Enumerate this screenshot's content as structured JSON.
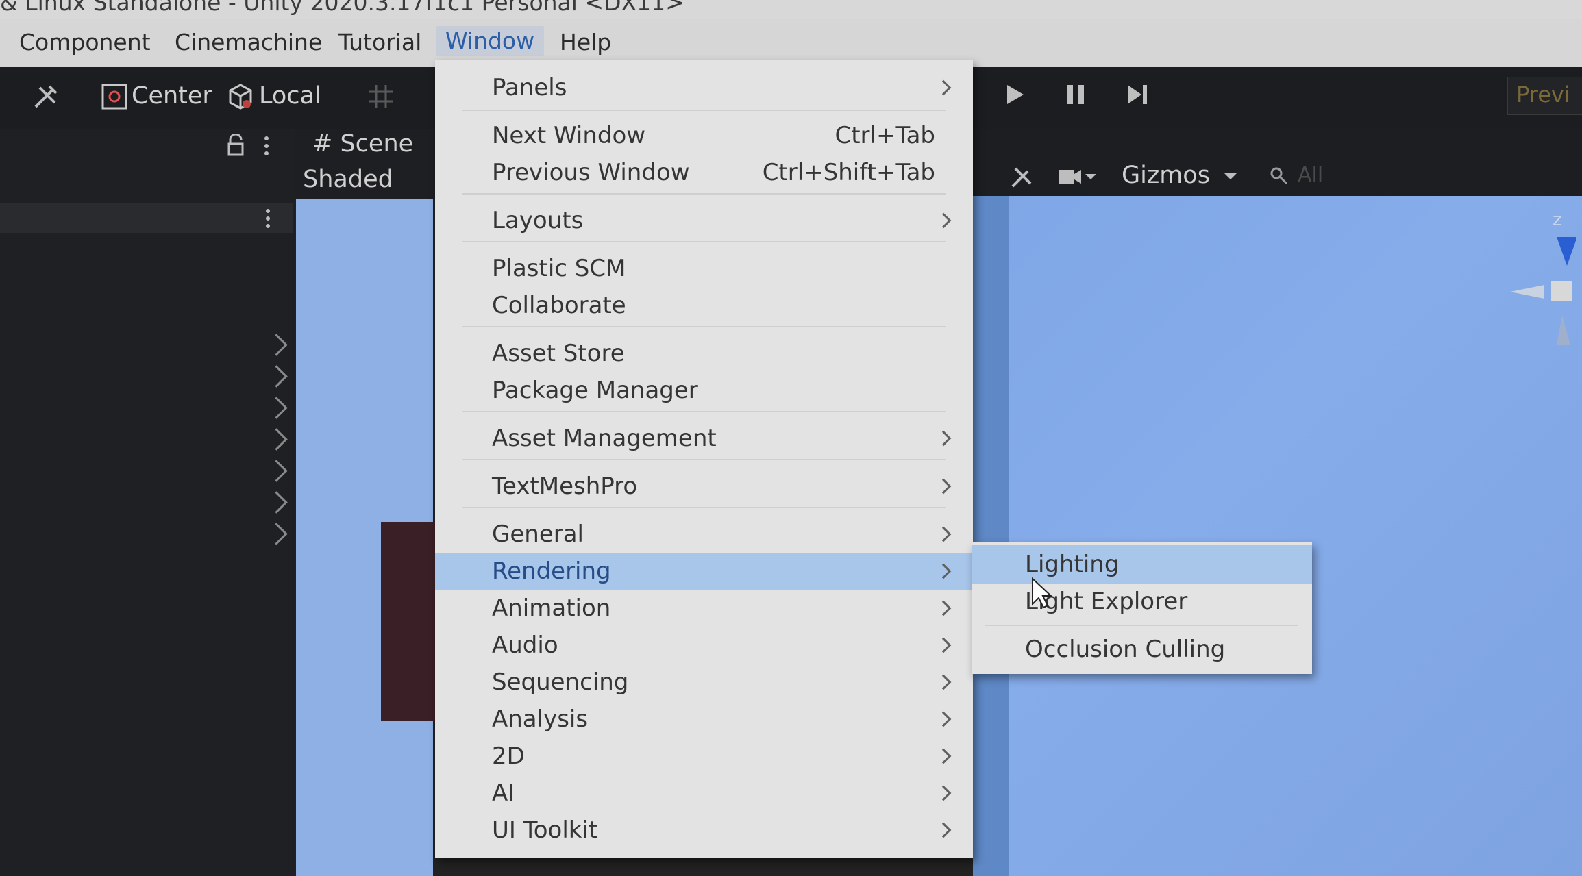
{
  "window": {
    "title": "& Linux Standalone - Unity 2020.3.17f1c1 Personal <DX11>"
  },
  "menubar": {
    "items": [
      {
        "label": "Component"
      },
      {
        "label": "Cinemachine"
      },
      {
        "label": "Tutorial"
      },
      {
        "label": "Window"
      },
      {
        "label": "Help"
      }
    ]
  },
  "toolbar": {
    "pivot_label": "Center",
    "space_label": "Local",
    "preview_label": "Previ"
  },
  "scene": {
    "tab_label": "# Scene",
    "shade_mode": "Shaded",
    "gizmos_label": "Gizmos",
    "search_label": "All",
    "axis_label": "z"
  },
  "window_menu": {
    "items": [
      {
        "label": "Panels",
        "shortcut": "",
        "submenu": true
      },
      {
        "label": "Next Window",
        "shortcut": "Ctrl+Tab",
        "submenu": false
      },
      {
        "label": "Previous Window",
        "shortcut": "Ctrl+Shift+Tab",
        "submenu": false
      },
      {
        "label": "Layouts",
        "shortcut": "",
        "submenu": true
      },
      {
        "label": "Plastic SCM",
        "shortcut": "",
        "submenu": false
      },
      {
        "label": "Collaborate",
        "shortcut": "",
        "submenu": false
      },
      {
        "label": "Asset Store",
        "shortcut": "",
        "submenu": false
      },
      {
        "label": "Package Manager",
        "shortcut": "",
        "submenu": false
      },
      {
        "label": "Asset Management",
        "shortcut": "",
        "submenu": true
      },
      {
        "label": "TextMeshPro",
        "shortcut": "",
        "submenu": true
      },
      {
        "label": "General",
        "shortcut": "",
        "submenu": true
      },
      {
        "label": "Rendering",
        "shortcut": "",
        "submenu": true
      },
      {
        "label": "Animation",
        "shortcut": "",
        "submenu": true
      },
      {
        "label": "Audio",
        "shortcut": "",
        "submenu": true
      },
      {
        "label": "Sequencing",
        "shortcut": "",
        "submenu": true
      },
      {
        "label": "Analysis",
        "shortcut": "",
        "submenu": true
      },
      {
        "label": "2D",
        "shortcut": "",
        "submenu": true
      },
      {
        "label": "AI",
        "shortcut": "",
        "submenu": true
      },
      {
        "label": "UI Toolkit",
        "shortcut": "",
        "submenu": true
      }
    ]
  },
  "rendering_submenu": {
    "items": [
      {
        "label": "Lighting"
      },
      {
        "label": "Light Explorer"
      },
      {
        "label": "Occlusion Culling"
      }
    ]
  },
  "colors": {
    "menu_bg": "#e3e3e3",
    "menu_highlight": "#a8c6ea",
    "editor_dark": "#1c1d20",
    "scene_sky": "#86acea"
  }
}
